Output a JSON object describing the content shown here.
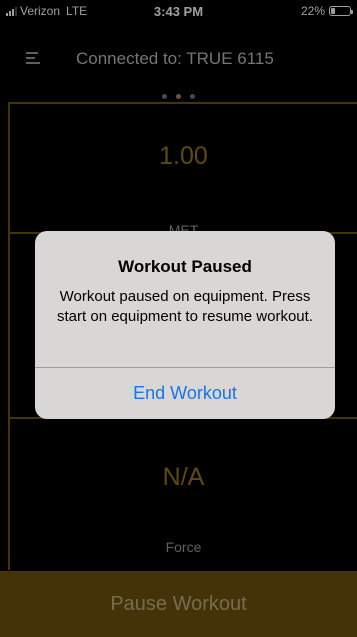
{
  "status_bar": {
    "carrier": "Verizon",
    "network": "LTE",
    "time": "3:43 PM",
    "battery_percent": "22%",
    "battery_level": 0.22
  },
  "header": {
    "title": "Connected to: TRUE 6115",
    "page_count": 3,
    "active_page": 2
  },
  "metrics": [
    {
      "value": "1.00",
      "label": "MET"
    },
    {
      "value": "N/A",
      "label": "Force"
    }
  ],
  "pause_button": {
    "label": "Pause Workout"
  },
  "alert": {
    "title": "Workout Paused",
    "message": "Workout paused on equipment. Press start on equipment to resume workout.",
    "action_label": "End Workout"
  },
  "colors": {
    "accent_gold": "#9b7718",
    "button_bg": "#6e520e",
    "link_blue": "#1a73e8"
  }
}
